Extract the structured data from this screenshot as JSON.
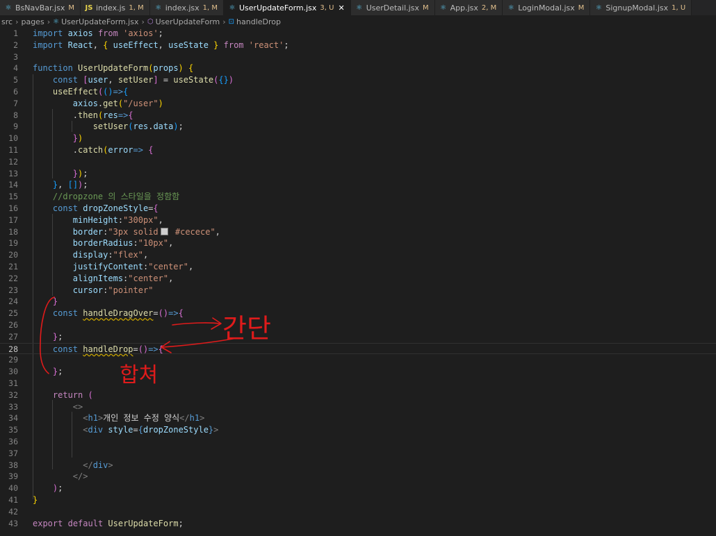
{
  "tabs": [
    {
      "label": "BsNavBar.jsx",
      "badge": "M",
      "icon": "react-icon",
      "active": false
    },
    {
      "label": "index.js",
      "badge": "1, M",
      "icon": "js-icon",
      "active": false
    },
    {
      "label": "index.jsx",
      "badge": "1, M",
      "icon": "react-icon",
      "active": false
    },
    {
      "label": "UserUpdateForm.jsx",
      "badge": "3, U",
      "icon": "react-icon",
      "active": true
    },
    {
      "label": "UserDetail.jsx",
      "badge": "M",
      "icon": "react-icon",
      "active": false
    },
    {
      "label": "App.jsx",
      "badge": "2, M",
      "icon": "react-icon",
      "active": false
    },
    {
      "label": "LoginModal.jsx",
      "badge": "M",
      "icon": "react-icon",
      "active": false
    },
    {
      "label": "SignupModal.jsx",
      "badge": "1, U",
      "icon": "react-icon",
      "active": false
    }
  ],
  "breadcrumb": [
    "src",
    "pages",
    "UserUpdateForm.jsx",
    "UserUpdateForm",
    "handleDrop"
  ],
  "current_line": 28,
  "annotations": {
    "right_text": "간단",
    "below_text": "합쳐"
  },
  "lines": [
    [
      [
        "kw",
        "import"
      ],
      [
        "punc",
        " "
      ],
      [
        "var",
        "axios"
      ],
      [
        "punc",
        " "
      ],
      [
        "ctl",
        "from"
      ],
      [
        "punc",
        " "
      ],
      [
        "str",
        "'axios'"
      ],
      [
        "punc",
        ";"
      ]
    ],
    [
      [
        "kw",
        "import"
      ],
      [
        "punc",
        " "
      ],
      [
        "var",
        "React"
      ],
      [
        "punc",
        ", "
      ],
      [
        "br1",
        "{"
      ],
      [
        "punc",
        " "
      ],
      [
        "var",
        "useEffect"
      ],
      [
        "punc",
        ", "
      ],
      [
        "var",
        "useState"
      ],
      [
        "punc",
        " "
      ],
      [
        "br1",
        "}"
      ],
      [
        "punc",
        " "
      ],
      [
        "ctl",
        "from"
      ],
      [
        "punc",
        " "
      ],
      [
        "str",
        "'react'"
      ],
      [
        "punc",
        ";"
      ]
    ],
    [],
    [
      [
        "kw",
        "function"
      ],
      [
        "punc",
        " "
      ],
      [
        "fn",
        "UserUpdateForm"
      ],
      [
        "br1",
        "("
      ],
      [
        "var",
        "props"
      ],
      [
        "br1",
        ")"
      ],
      [
        "punc",
        " "
      ],
      [
        "br1",
        "{"
      ]
    ],
    [
      [
        "punc",
        "    "
      ],
      [
        "kw",
        "const"
      ],
      [
        "punc",
        " "
      ],
      [
        "br2",
        "["
      ],
      [
        "var",
        "user"
      ],
      [
        "punc",
        ", "
      ],
      [
        "fn",
        "setUser"
      ],
      [
        "br2",
        "]"
      ],
      [
        "punc",
        " = "
      ],
      [
        "fn",
        "useState"
      ],
      [
        "br2",
        "("
      ],
      [
        "br3",
        "{}"
      ],
      [
        "br2",
        ")"
      ]
    ],
    [
      [
        "punc",
        "    "
      ],
      [
        "fn",
        "useEffect"
      ],
      [
        "br2",
        "("
      ],
      [
        "br3",
        "()"
      ],
      [
        "kw",
        "=>"
      ],
      [
        "br3",
        "{"
      ]
    ],
    [
      [
        "punc",
        "        "
      ],
      [
        "var",
        "axios"
      ],
      [
        "punc",
        "."
      ],
      [
        "fn",
        "get"
      ],
      [
        "br1",
        "("
      ],
      [
        "str",
        "\"/user\""
      ],
      [
        "br1",
        ")"
      ]
    ],
    [
      [
        "punc",
        "        ."
      ],
      [
        "fn",
        "then"
      ],
      [
        "br1",
        "("
      ],
      [
        "var",
        "res"
      ],
      [
        "kw",
        "=>"
      ],
      [
        "br2",
        "{"
      ]
    ],
    [
      [
        "punc",
        "            "
      ],
      [
        "fn",
        "setUser"
      ],
      [
        "br3",
        "("
      ],
      [
        "var",
        "res"
      ],
      [
        "punc",
        "."
      ],
      [
        "var",
        "data"
      ],
      [
        "br3",
        ")"
      ],
      [
        "punc",
        ";"
      ]
    ],
    [
      [
        "punc",
        "        "
      ],
      [
        "br2",
        "}"
      ],
      [
        "br1",
        ")"
      ]
    ],
    [
      [
        "punc",
        "        ."
      ],
      [
        "fn",
        "catch"
      ],
      [
        "br1",
        "("
      ],
      [
        "var",
        "error"
      ],
      [
        "kw",
        "=>"
      ],
      [
        "punc",
        " "
      ],
      [
        "br2",
        "{"
      ]
    ],
    [],
    [
      [
        "punc",
        "        "
      ],
      [
        "br2",
        "}"
      ],
      [
        "br1",
        ")"
      ],
      [
        "punc",
        ";"
      ]
    ],
    [
      [
        "punc",
        "    "
      ],
      [
        "br3",
        "}"
      ],
      [
        "punc",
        ", "
      ],
      [
        "br3",
        "[]"
      ],
      [
        "br2",
        ")"
      ],
      [
        "punc",
        ";"
      ]
    ],
    [
      [
        "punc",
        "    "
      ],
      [
        "cmt",
        "//dropzone 의 스타일을 정함함"
      ]
    ],
    [
      [
        "punc",
        "    "
      ],
      [
        "kw",
        "const"
      ],
      [
        "punc",
        " "
      ],
      [
        "var",
        "dropZoneStyle"
      ],
      [
        "punc",
        "="
      ],
      [
        "br2",
        "{"
      ]
    ],
    [
      [
        "punc",
        "        "
      ],
      [
        "var",
        "minHeight"
      ],
      [
        "punc",
        ":"
      ],
      [
        "str",
        "\"300px\""
      ],
      [
        "punc",
        ","
      ]
    ],
    [
      [
        "punc",
        "        "
      ],
      [
        "var",
        "border"
      ],
      [
        "punc",
        ":"
      ],
      [
        "str",
        "\"3px solid"
      ],
      [
        "swatch",
        ""
      ],
      [
        "str",
        " #cecece\""
      ],
      [
        "punc",
        ","
      ]
    ],
    [
      [
        "punc",
        "        "
      ],
      [
        "var",
        "borderRadius"
      ],
      [
        "punc",
        ":"
      ],
      [
        "str",
        "\"10px\""
      ],
      [
        "punc",
        ","
      ]
    ],
    [
      [
        "punc",
        "        "
      ],
      [
        "var",
        "display"
      ],
      [
        "punc",
        ":"
      ],
      [
        "str",
        "\"flex\""
      ],
      [
        "punc",
        ","
      ]
    ],
    [
      [
        "punc",
        "        "
      ],
      [
        "var",
        "justifyContent"
      ],
      [
        "punc",
        ":"
      ],
      [
        "str",
        "\"center\""
      ],
      [
        "punc",
        ","
      ]
    ],
    [
      [
        "punc",
        "        "
      ],
      [
        "var",
        "alignItems"
      ],
      [
        "punc",
        ":"
      ],
      [
        "str",
        "\"center\""
      ],
      [
        "punc",
        ","
      ]
    ],
    [
      [
        "punc",
        "        "
      ],
      [
        "var",
        "cursor"
      ],
      [
        "punc",
        ":"
      ],
      [
        "str",
        "\"pointer\""
      ]
    ],
    [
      [
        "punc",
        "    "
      ],
      [
        "br2",
        "}"
      ]
    ],
    [
      [
        "punc",
        "    "
      ],
      [
        "kw",
        "const"
      ],
      [
        "punc",
        " "
      ],
      [
        "fnsq",
        "handleDragOver"
      ],
      [
        "punc",
        "="
      ],
      [
        "br2",
        "()"
      ],
      [
        "kw",
        "=>"
      ],
      [
        "br2",
        "{"
      ]
    ],
    [],
    [
      [
        "punc",
        "    "
      ],
      [
        "br2",
        "}"
      ],
      [
        "punc",
        ";"
      ]
    ],
    [
      [
        "punc",
        "    "
      ],
      [
        "kw",
        "const"
      ],
      [
        "punc",
        " "
      ],
      [
        "fnsq",
        "handleDrop"
      ],
      [
        "punc",
        "="
      ],
      [
        "br2",
        "()"
      ],
      [
        "kw",
        "=>"
      ],
      [
        "br2",
        "{"
      ]
    ],
    [],
    [
      [
        "punc",
        "    "
      ],
      [
        "br2",
        "}"
      ],
      [
        "punc",
        ";"
      ]
    ],
    [],
    [
      [
        "punc",
        "    "
      ],
      [
        "ctl",
        "return"
      ],
      [
        "punc",
        " "
      ],
      [
        "br2",
        "("
      ]
    ],
    [
      [
        "punc",
        "        "
      ],
      [
        "tagpunc",
        "<>"
      ]
    ],
    [
      [
        "punc",
        "          "
      ],
      [
        "tagpunc",
        "<"
      ],
      [
        "tag",
        "h1"
      ],
      [
        "tagpunc",
        ">"
      ],
      [
        "punc",
        "개인 정보 수정 양식"
      ],
      [
        "tagpunc",
        "</"
      ],
      [
        "tag",
        "h1"
      ],
      [
        "tagpunc",
        ">"
      ]
    ],
    [
      [
        "punc",
        "          "
      ],
      [
        "tagpunc",
        "<"
      ],
      [
        "tag",
        "div"
      ],
      [
        "punc",
        " "
      ],
      [
        "var",
        "style"
      ],
      [
        "punc",
        "="
      ],
      [
        "kw",
        "{"
      ],
      [
        "var",
        "dropZoneStyle"
      ],
      [
        "kw",
        "}"
      ],
      [
        "tagpunc",
        ">"
      ]
    ],
    [],
    [],
    [
      [
        "punc",
        "          "
      ],
      [
        "tagpunc",
        "</"
      ],
      [
        "tag",
        "div"
      ],
      [
        "tagpunc",
        ">"
      ]
    ],
    [
      [
        "punc",
        "        "
      ],
      [
        "tagpunc",
        "</>"
      ]
    ],
    [
      [
        "punc",
        "    "
      ],
      [
        "br2",
        ")"
      ],
      [
        "punc",
        ";"
      ]
    ],
    [
      [
        "br1",
        "}"
      ]
    ],
    [],
    [
      [
        "ctl",
        "export"
      ],
      [
        "punc",
        " "
      ],
      [
        "ctl",
        "default"
      ],
      [
        "punc",
        " "
      ],
      [
        "fn",
        "UserUpdateForm"
      ],
      [
        "punc",
        ";"
      ]
    ]
  ]
}
